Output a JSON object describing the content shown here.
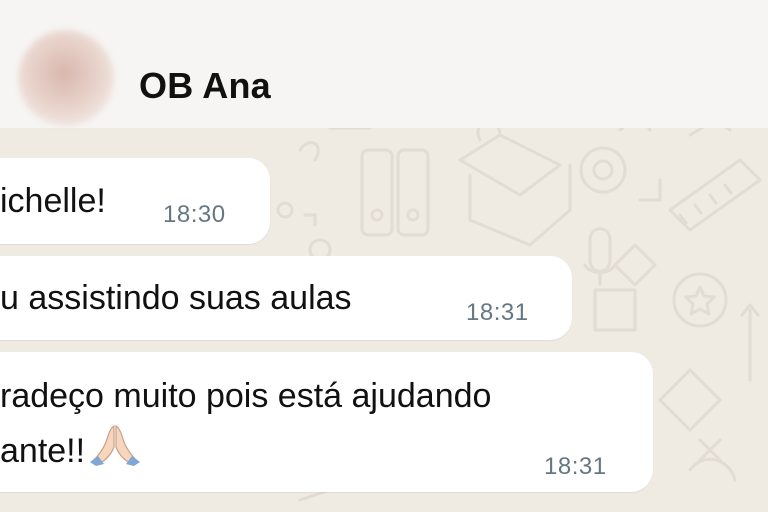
{
  "chat_header": {
    "contact_name": "OB Ana",
    "avatar_icon": "blurred-avatar"
  },
  "messages": [
    {
      "text": "ichelle!",
      "time": "18:30"
    },
    {
      "text": "u assistindo suas aulas",
      "time": "18:31"
    },
    {
      "lines": [
        "radeço muito pois está ajudando",
        "ante!!"
      ],
      "emoji": "folded-hands-icon",
      "time": "18:31"
    }
  ],
  "colors": {
    "wallpaper": "#efeae2",
    "bubble": "#ffffff",
    "timestamp": "#667781"
  }
}
